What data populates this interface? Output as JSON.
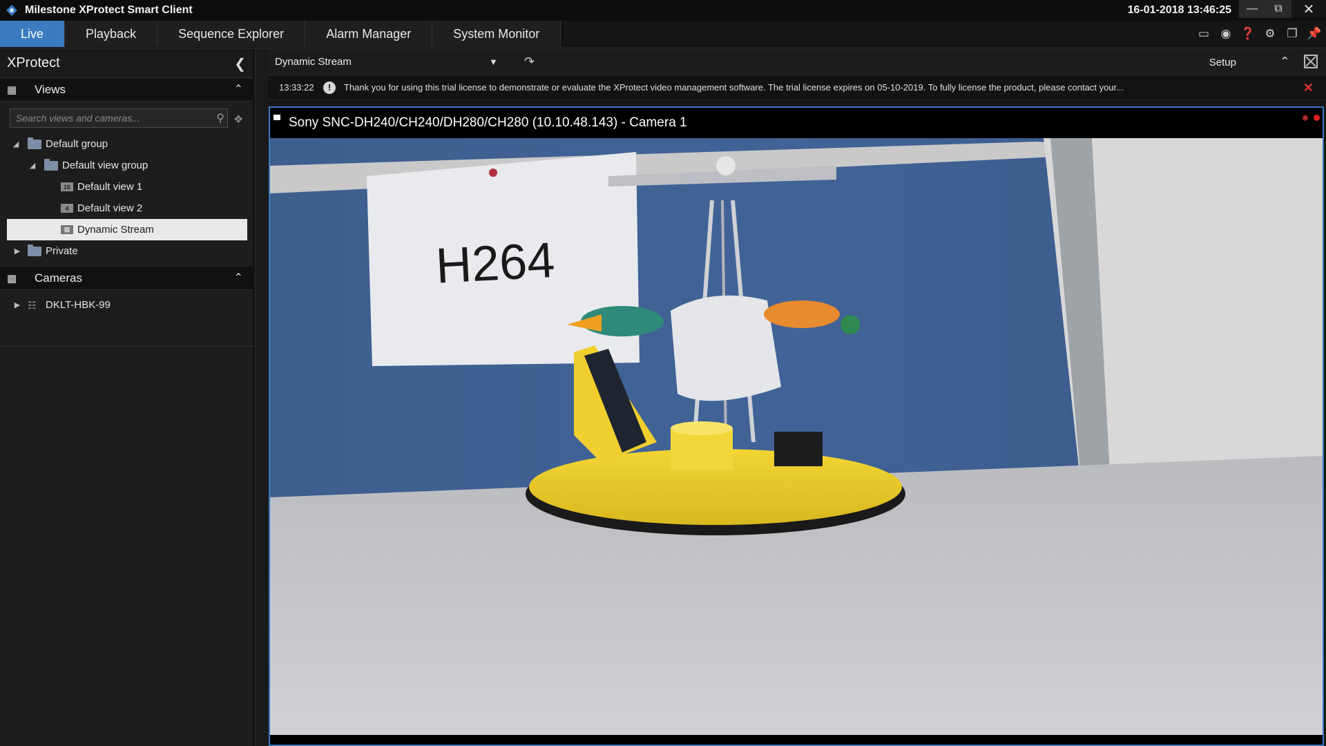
{
  "window": {
    "title": "Milestone XProtect Smart Client",
    "datetime": "16-01-2018 13:46:25"
  },
  "tabs": [
    {
      "label": "Live"
    },
    {
      "label": "Playback"
    },
    {
      "label": "Sequence Explorer"
    },
    {
      "label": "Alarm Manager"
    },
    {
      "label": "System Monitor"
    }
  ],
  "sidebar": {
    "title": "XProtect",
    "views_label": "Views",
    "search_placeholder": "Search views and cameras...",
    "tree": {
      "default_group": "Default group",
      "default_view_group": "Default view group",
      "view1": {
        "label": "Default view 1",
        "badge": "16"
      },
      "view2": {
        "label": "Default view 2",
        "badge": "4"
      },
      "dynamic": {
        "label": "Dynamic Stream"
      },
      "private": "Private"
    },
    "cameras_label": "Cameras",
    "camera_server": "DKLT-HBK-99"
  },
  "viewbar": {
    "current_view": "Dynamic Stream",
    "setup_label": "Setup"
  },
  "notice": {
    "time": "13:33:22",
    "message": "Thank you for using this trial license to demonstrate or evaluate the XProtect video management software. The trial license expires on 05-10-2019. To fully license the product, please contact your..."
  },
  "camera": {
    "title": "Sony SNC-DH240/CH240/DH280/CH280 (10.10.48.143) - Camera 1",
    "scene_sign_text": "H264"
  },
  "colors": {
    "accent": "#3b7bc0",
    "alert": "#e03030"
  }
}
